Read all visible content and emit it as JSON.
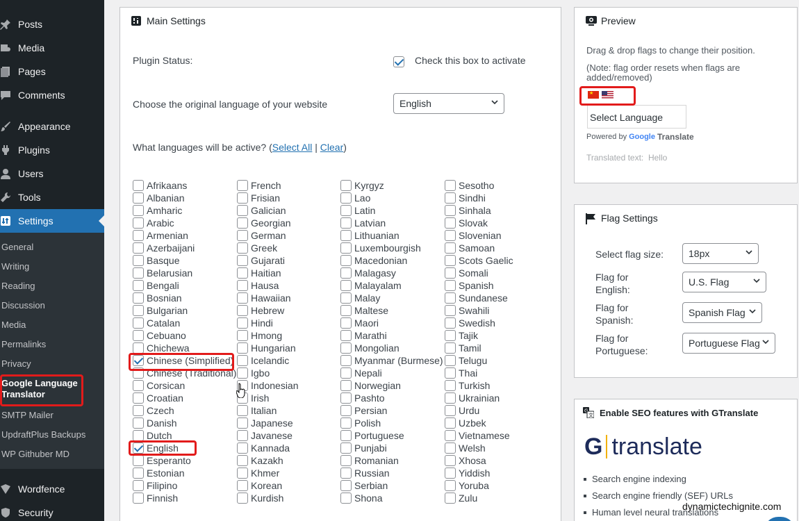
{
  "sidebar": {
    "menu": [
      {
        "label": "Posts",
        "icon": "pin-icon"
      },
      {
        "label": "Media",
        "icon": "media-icon"
      },
      {
        "label": "Pages",
        "icon": "pages-icon"
      },
      {
        "label": "Comments",
        "icon": "comments-icon"
      },
      {
        "label": "Appearance",
        "icon": "brush-icon"
      },
      {
        "label": "Plugins",
        "icon": "plugin-icon"
      },
      {
        "label": "Users",
        "icon": "users-icon"
      },
      {
        "label": "Tools",
        "icon": "wrench-icon"
      },
      {
        "label": "Settings",
        "icon": "settings-icon"
      }
    ],
    "submenu": [
      "General",
      "Writing",
      "Reading",
      "Discussion",
      "Media",
      "Permalinks",
      "Privacy",
      "Google Language Translator",
      "SMTP Mailer",
      "UpdraftPlus Backups",
      "WP Githuber MD"
    ],
    "bottom": [
      {
        "label": "Wordfence",
        "icon": "wordfence-icon"
      },
      {
        "label": "Security",
        "icon": "shield-icon"
      }
    ]
  },
  "main": {
    "title": "Main Settings",
    "plugin_status_label": "Plugin Status:",
    "activate_label": "Check this box to activate",
    "original_lang_label": "Choose the original language of your website",
    "original_lang_value": "English",
    "active_langs_prefix": "What languages will be active? (",
    "select_all": "Select All",
    "separator": "|",
    "clear": "Clear",
    "active_langs_suffix": ")",
    "languages": [
      [
        "Afrikaans",
        "Albanian",
        "Amharic",
        "Arabic",
        "Armenian",
        "Azerbaijani",
        "Basque",
        "Belarusian",
        "Bengali",
        "Bosnian",
        "Bulgarian",
        "Catalan",
        "Cebuano",
        "Chichewa",
        "Chinese (Simplified)",
        "Chinese (Traditional)",
        "Corsican",
        "Croatian",
        "Czech",
        "Danish",
        "Dutch",
        "English",
        "Esperanto",
        "Estonian",
        "Filipino",
        "Finnish"
      ],
      [
        "French",
        "Frisian",
        "Galician",
        "Georgian",
        "German",
        "Greek",
        "Gujarati",
        "Haitian",
        "Hausa",
        "Hawaiian",
        "Hebrew",
        "Hindi",
        "Hmong",
        "Hungarian",
        "Icelandic",
        "Igbo",
        "Indonesian",
        "Irish",
        "Italian",
        "Japanese",
        "Javanese",
        "Kannada",
        "Kazakh",
        "Khmer",
        "Korean",
        "Kurdish"
      ],
      [
        "Kyrgyz",
        "Lao",
        "Latin",
        "Latvian",
        "Lithuanian",
        "Luxembourgish",
        "Macedonian",
        "Malagasy",
        "Malayalam",
        "Malay",
        "Maltese",
        "Maori",
        "Marathi",
        "Mongolian",
        "Myanmar (Burmese)",
        "Nepali",
        "Norwegian",
        "Pashto",
        "Persian",
        "Polish",
        "Portuguese",
        "Punjabi",
        "Romanian",
        "Russian",
        "Serbian",
        "Shona"
      ],
      [
        "Sesotho",
        "Sindhi",
        "Sinhala",
        "Slovak",
        "Slovenian",
        "Samoan",
        "Scots Gaelic",
        "Somali",
        "Spanish",
        "Sundanese",
        "Swahili",
        "Swedish",
        "Tajik",
        "Tamil",
        "Telugu",
        "Thai",
        "Turkish",
        "Ukrainian",
        "Urdu",
        "Uzbek",
        "Vietnamese",
        "Welsh",
        "Xhosa",
        "Yiddish",
        "Yoruba",
        "Zulu"
      ]
    ],
    "checked": [
      "Chinese (Simplified)",
      "English"
    ]
  },
  "preview": {
    "title": "Preview",
    "drag_text": "Drag & drop flags to change their position.",
    "note_text": "(Note: flag order resets when flags are added/removed)",
    "select_language": "Select Language",
    "powered_by": "Powered by",
    "google": "Google",
    "translate": "Translate",
    "translated_text_label": "Translated text:",
    "translated_text_value": "Hello"
  },
  "flag_settings": {
    "title": "Flag Settings",
    "rows": [
      {
        "label": "Select flag size:",
        "value": "18px"
      },
      {
        "label": "Flag for English:",
        "value": "U.S. Flag"
      },
      {
        "label": "Flag for Spanish:",
        "value": "Spanish Flag"
      },
      {
        "label": "Flag for Portuguese:",
        "value": "Portuguese Flag"
      }
    ]
  },
  "seo": {
    "title": "Enable SEO features with GTranslate",
    "logo_g": "G",
    "logo_text": "translate",
    "bullets": [
      "Search engine indexing",
      "Search engine friendly (SEF) URLs",
      "Human level neural translations"
    ]
  },
  "watermark": "dynamictechignite.com",
  "colors": {
    "accent": "#2271b1",
    "sidebar": "#1d2327",
    "highlight": "#e21b1b"
  }
}
